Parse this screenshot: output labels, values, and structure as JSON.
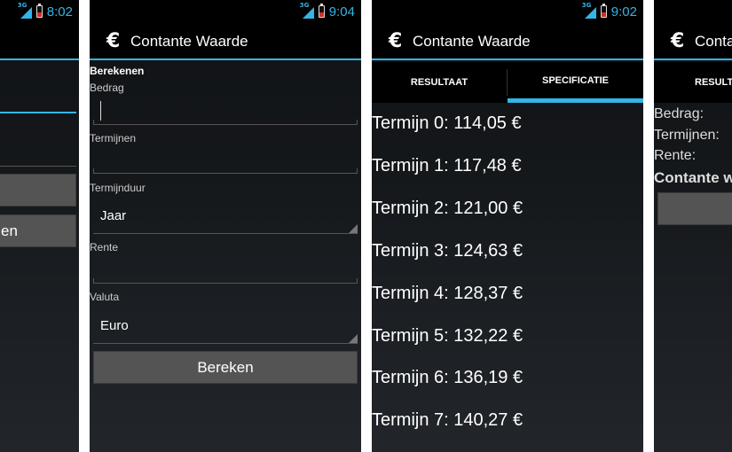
{
  "app": {
    "title": "Contante Waarde",
    "icon": "euro-icon"
  },
  "colors": {
    "accent": "#33b5e5",
    "battery": "#d42f21",
    "button": "#545454"
  },
  "screen1": {
    "status": {
      "network": "3G",
      "time": "8:02"
    },
    "button_label": "en"
  },
  "screen2": {
    "status": {
      "network": "3G",
      "time": "9:04"
    },
    "section_title": "Berekenen",
    "bedrag_label": "Bedrag",
    "termijnen_label": "Termijnen",
    "termijnduur_label": "Termijnduur",
    "termijnduur_value": "Jaar",
    "rente_label": "Rente",
    "valuta_label": "Valuta",
    "valuta_value": "Euro",
    "submit_label": "Bereken"
  },
  "screen3": {
    "status": {
      "network": "3G",
      "time": "9:02"
    },
    "tabs": [
      "RESULTAAT",
      "SPECIFICATIE"
    ],
    "terms": [
      "Termijn 0: 114,05 €",
      "Termijn 1: 117,48 €",
      "Termijn 2: 121,00 €",
      "Termijn 3: 124,63 €",
      "Termijn 4: 128,37 €",
      "Termijn 5: 132,22 €",
      "Termijn 6: 136,19 €",
      "Termijn 7: 140,27 €"
    ]
  },
  "screen4": {
    "title_partial": "Conta",
    "tab_partial": "RESULTA",
    "bedrag_label": "Bedrag:",
    "termijnen_label": "Termijnen:",
    "rente_label": "Rente:",
    "total_partial": "Contante w"
  }
}
